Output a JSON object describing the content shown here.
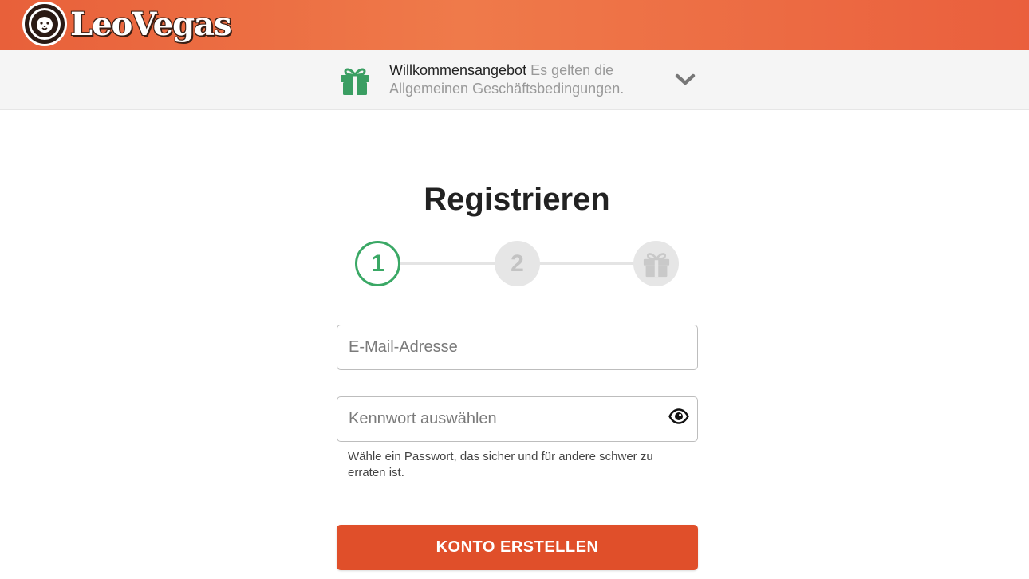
{
  "brand": {
    "logo_text": "LeoVegas",
    "header_color": "#ec6a42"
  },
  "offer": {
    "title": "Willkommensangebot",
    "terms": "Es gelten die Allgemeinen Geschäftsbedingungen.",
    "gift_icon": "gift-icon",
    "gift_color": "#3a9e62",
    "toggle_icon": "chevron-down-icon"
  },
  "page": {
    "title": "Registrieren"
  },
  "stepper": {
    "steps": [
      {
        "label": "1",
        "state": "active"
      },
      {
        "label": "2",
        "state": "inactive"
      },
      {
        "label": "",
        "icon": "gift-icon",
        "state": "inactive"
      }
    ],
    "active_color": "#3aa865"
  },
  "form": {
    "email": {
      "placeholder": "E-Mail-Adresse",
      "value": ""
    },
    "password": {
      "placeholder": "Kennwort auswählen",
      "value": "",
      "toggle_icon": "eye-icon"
    },
    "password_hint": "Wähle ein Passwort, das sicher und für andere schwer zu erraten ist.",
    "submit_label": "KONTO ERSTELLEN",
    "submit_color": "#e04f2a"
  }
}
